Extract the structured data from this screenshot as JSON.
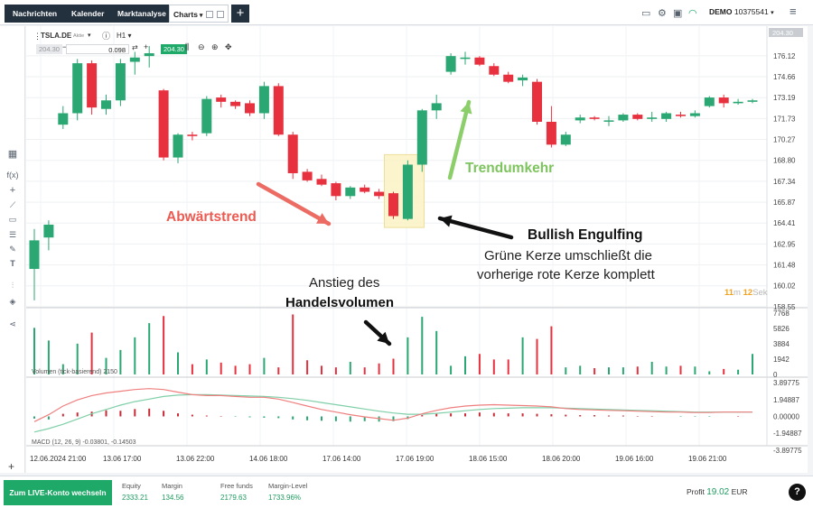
{
  "tabs": [
    {
      "label": "Nachrichten"
    },
    {
      "label": "Kalender"
    },
    {
      "label": "Marktanalyse"
    },
    {
      "label": "Charts"
    }
  ],
  "account": {
    "mode": "DEMO",
    "number": "10375541"
  },
  "toolbar": {
    "symbol": "TSLA.DE",
    "symbol_sub": "Aktie",
    "timeframe": "H1",
    "price_left": "204.30",
    "lots": "0.098",
    "price_right": "204.30"
  },
  "price_axis": [
    "176.12",
    "174.66",
    "173.19",
    "171.73",
    "170.27",
    "168.80",
    "167.34",
    "165.87",
    "164.41",
    "162.95",
    "161.48",
    "160.02",
    "158.55"
  ],
  "last_price": "204.30",
  "volume_axis": [
    "7768",
    "5826",
    "3884",
    "1942",
    "0"
  ],
  "macd_axis": [
    "3.89775",
    "1.94887",
    "0.00000",
    "-1.94887",
    "-3.89775"
  ],
  "time_axis": [
    "12.06.2024 21:00",
    "13.06 17:00",
    "13.06 22:00",
    "14.06 18:00",
    "17.06 14:00",
    "17.06 19:00",
    "18.06 15:00",
    "18.06 20:00",
    "19.06 16:00",
    "19.06 21:00"
  ],
  "indicators": {
    "volume_label": "Volumen (tick-basierend) 2150",
    "macd_label": "MACD (12, 26, 9) -0.03801, -0.14503"
  },
  "countdown": {
    "min": "11",
    "m": "m",
    "sec": "12",
    "s": "Sek"
  },
  "annotations": {
    "downtrend": "Abwärtstrend",
    "reversal": "Trendumkehr",
    "engulf_title": "Bullish Engulfing",
    "engulf_line1": "Grüne Kerze umschließt die",
    "engulf_line2": "vorherige rote Kerze komplett",
    "volume_line1": "Anstieg des",
    "volume_line2": "Handelsvolumen"
  },
  "footer": {
    "live_button": "Zum LIVE-Konto wechseln",
    "stats": [
      {
        "label": "Equity",
        "value": "2333.21"
      },
      {
        "label": "Margin",
        "value": "134.56"
      },
      {
        "label": "Free funds",
        "value": "2179.63"
      },
      {
        "label": "Margin-Level",
        "value": "1733.96%"
      }
    ],
    "profit_label": "Profit",
    "profit_value": "19.02",
    "currency": "EUR",
    "help": "?"
  },
  "chart_data": {
    "type": "candlestick",
    "symbol": "TSLA.DE",
    "timeframe": "H1",
    "y_range": [
      158.55,
      177.5
    ],
    "candles": [
      {
        "o": 161.2,
        "h": 164.0,
        "l": 159.0,
        "c": 163.2
      },
      {
        "o": 163.4,
        "h": 164.6,
        "l": 162.5,
        "c": 164.3
      },
      {
        "o": 171.3,
        "h": 172.6,
        "l": 171.0,
        "c": 172.1
      },
      {
        "o": 172.1,
        "h": 175.9,
        "l": 171.6,
        "c": 175.6
      },
      {
        "o": 175.6,
        "h": 175.8,
        "l": 172.0,
        "c": 172.5
      },
      {
        "o": 172.4,
        "h": 173.4,
        "l": 172.0,
        "c": 173.0
      },
      {
        "o": 173.0,
        "h": 175.9,
        "l": 172.6,
        "c": 175.6
      },
      {
        "o": 175.7,
        "h": 176.4,
        "l": 174.8,
        "c": 176.0
      },
      {
        "o": 176.1,
        "h": 176.8,
        "l": 175.3,
        "c": 176.3
      },
      {
        "o": 173.7,
        "h": 173.8,
        "l": 168.8,
        "c": 169.0
      },
      {
        "o": 169.0,
        "h": 170.7,
        "l": 168.6,
        "c": 170.6
      },
      {
        "o": 170.6,
        "h": 170.8,
        "l": 170.2,
        "c": 170.5
      },
      {
        "o": 170.7,
        "h": 173.3,
        "l": 170.5,
        "c": 173.1
      },
      {
        "o": 173.2,
        "h": 173.4,
        "l": 172.5,
        "c": 172.9
      },
      {
        "o": 172.9,
        "h": 173.0,
        "l": 172.4,
        "c": 172.6
      },
      {
        "o": 172.8,
        "h": 173.0,
        "l": 171.9,
        "c": 172.1
      },
      {
        "o": 172.1,
        "h": 174.3,
        "l": 171.7,
        "c": 174.0
      },
      {
        "o": 174.0,
        "h": 174.2,
        "l": 170.5,
        "c": 170.6
      },
      {
        "o": 170.6,
        "h": 170.8,
        "l": 167.5,
        "c": 167.9
      },
      {
        "o": 168.0,
        "h": 168.2,
        "l": 167.3,
        "c": 167.4
      },
      {
        "o": 167.5,
        "h": 167.8,
        "l": 167.0,
        "c": 167.1
      },
      {
        "o": 167.2,
        "h": 167.3,
        "l": 166.0,
        "c": 166.3
      },
      {
        "o": 166.3,
        "h": 167.0,
        "l": 166.1,
        "c": 166.9
      },
      {
        "o": 166.9,
        "h": 167.1,
        "l": 166.5,
        "c": 166.6
      },
      {
        "o": 166.6,
        "h": 166.8,
        "l": 166.1,
        "c": 166.3
      },
      {
        "o": 166.5,
        "h": 166.6,
        "l": 164.7,
        "c": 164.9
      },
      {
        "o": 164.7,
        "h": 168.8,
        "l": 164.6,
        "c": 168.5
      },
      {
        "o": 168.5,
        "h": 172.4,
        "l": 168.0,
        "c": 172.3
      },
      {
        "o": 172.3,
        "h": 173.4,
        "l": 171.7,
        "c": 172.8
      },
      {
        "o": 175.0,
        "h": 176.3,
        "l": 174.8,
        "c": 176.1
      },
      {
        "o": 175.9,
        "h": 176.4,
        "l": 175.5,
        "c": 176.0
      },
      {
        "o": 176.0,
        "h": 176.1,
        "l": 175.4,
        "c": 175.5
      },
      {
        "o": 175.4,
        "h": 175.6,
        "l": 174.7,
        "c": 174.8
      },
      {
        "o": 174.8,
        "h": 175.0,
        "l": 174.2,
        "c": 174.3
      },
      {
        "o": 174.4,
        "h": 174.8,
        "l": 174.0,
        "c": 174.6
      },
      {
        "o": 174.3,
        "h": 174.5,
        "l": 171.3,
        "c": 171.5
      },
      {
        "o": 171.5,
        "h": 172.6,
        "l": 169.7,
        "c": 169.9
      },
      {
        "o": 169.9,
        "h": 170.8,
        "l": 169.8,
        "c": 170.6
      },
      {
        "o": 171.6,
        "h": 172.0,
        "l": 171.4,
        "c": 171.8
      },
      {
        "o": 171.8,
        "h": 171.9,
        "l": 171.6,
        "c": 171.7
      },
      {
        "o": 171.6,
        "h": 171.9,
        "l": 171.2,
        "c": 171.6
      },
      {
        "o": 171.6,
        "h": 172.1,
        "l": 171.5,
        "c": 172.0
      },
      {
        "o": 172.0,
        "h": 172.1,
        "l": 171.6,
        "c": 171.7
      },
      {
        "o": 171.7,
        "h": 172.2,
        "l": 171.5,
        "c": 171.8
      },
      {
        "o": 171.7,
        "h": 172.2,
        "l": 171.5,
        "c": 172.1
      },
      {
        "o": 172.0,
        "h": 172.2,
        "l": 171.8,
        "c": 171.9
      },
      {
        "o": 171.9,
        "h": 172.3,
        "l": 171.8,
        "c": 172.1
      },
      {
        "o": 172.6,
        "h": 173.3,
        "l": 172.5,
        "c": 173.2
      },
      {
        "o": 173.2,
        "h": 173.4,
        "l": 172.5,
        "c": 172.8
      },
      {
        "o": 172.8,
        "h": 173.1,
        "l": 172.7,
        "c": 172.9
      },
      {
        "o": 172.9,
        "h": 173.1,
        "l": 172.8,
        "c": 173.0
      }
    ],
    "volume": [
      5900,
      4300,
      1300,
      3900,
      5300,
      2100,
      3100,
      4700,
      6500,
      7400,
      2800,
      1300,
      1900,
      1500,
      1100,
      1300,
      2100,
      900,
      7600,
      1800,
      1100,
      900,
      1600,
      900,
      1400,
      2000,
      4700,
      7300,
      5500,
      1100,
      2300,
      2600,
      1900,
      1900,
      4700,
      4500,
      6100,
      900,
      1100,
      800,
      900,
      900,
      1000,
      1600,
      1000,
      1100,
      1000,
      400,
      700,
      600,
      2600
    ],
    "volume_ylim": [
      0,
      7768
    ],
    "macd_hist": [
      -0.25,
      -0.35,
      0.3,
      0.45,
      0.55,
      0.7,
      0.65,
      0.85,
      0.9,
      0.65,
      0.35,
      0.2,
      0.1,
      0.05,
      -0.05,
      -0.1,
      -0.15,
      -0.2,
      -0.35,
      -0.45,
      -0.5,
      -0.55,
      -0.6,
      -0.55,
      -0.6,
      -0.55,
      -0.3,
      0.15,
      0.3,
      0.35,
      0.35,
      0.45,
      0.4,
      0.35,
      0.35,
      0.3,
      0.25,
      0.2,
      0.15,
      0.15,
      0.1,
      0.1,
      0.05,
      0.05,
      0.0,
      -0.05,
      -0.05,
      -0.05,
      0.0,
      0.05,
      0.0
    ],
    "macd_line": [
      -0.6,
      0.2,
      1.2,
      1.9,
      2.4,
      2.7,
      2.9,
      3.1,
      3.2,
      3.1,
      2.8,
      2.5,
      2.4,
      2.4,
      2.3,
      2.2,
      2.2,
      2.0,
      1.6,
      1.2,
      0.8,
      0.5,
      0.2,
      -0.05,
      -0.25,
      -0.45,
      -0.2,
      0.3,
      0.7,
      1.0,
      1.2,
      1.3,
      1.35,
      1.3,
      1.25,
      1.2,
      1.1,
      0.9,
      0.8,
      0.75,
      0.7,
      0.65,
      0.6,
      0.55,
      0.5,
      0.5,
      0.45,
      0.45,
      0.5,
      0.5,
      0.5
    ],
    "macd_signal": [
      -1.8,
      -1.4,
      -0.9,
      -0.3,
      0.3,
      0.8,
      1.3,
      1.7,
      2.0,
      2.3,
      2.45,
      2.5,
      2.5,
      2.45,
      2.4,
      2.35,
      2.3,
      2.2,
      2.05,
      1.85,
      1.6,
      1.35,
      1.1,
      0.85,
      0.6,
      0.4,
      0.25,
      0.25,
      0.35,
      0.5,
      0.65,
      0.8,
      0.9,
      0.95,
      1.0,
      1.0,
      1.0,
      0.95,
      0.9,
      0.85,
      0.8,
      0.75,
      0.7,
      0.65,
      0.6,
      0.55,
      0.5,
      0.5,
      0.5,
      0.5,
      0.5
    ],
    "macd_ylim": [
      -3.89775,
      3.89775
    ]
  }
}
